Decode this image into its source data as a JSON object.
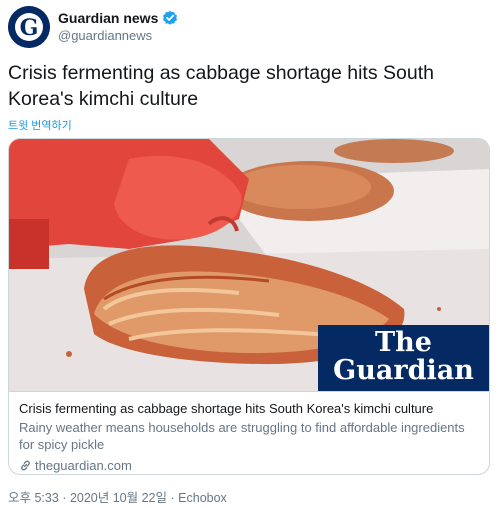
{
  "account": {
    "display_name": "Guardian news",
    "handle": "@guardiannews",
    "avatar_letter": "G",
    "brand_color": "#052962",
    "verified_color": "#1da1f2"
  },
  "tweet": {
    "text": "Crisis fermenting as cabbage shortage hits South Korea's kimchi culture",
    "translate_label": "트윗 번역하기"
  },
  "card": {
    "brand_line1": "The",
    "brand_line2": "Guardian",
    "title": "Crisis fermenting as cabbage shortage hits South Korea's kimchi culture",
    "description": "Rainy weather means households are struggling to find affordable ingredients for spicy pickle",
    "link_icon": "link-icon",
    "domain": "theguardian.com"
  },
  "meta": {
    "time": "오후 5:33",
    "separator1": "·",
    "date": "2020년 10월 22일",
    "separator2": "·",
    "source": "Echobox"
  }
}
